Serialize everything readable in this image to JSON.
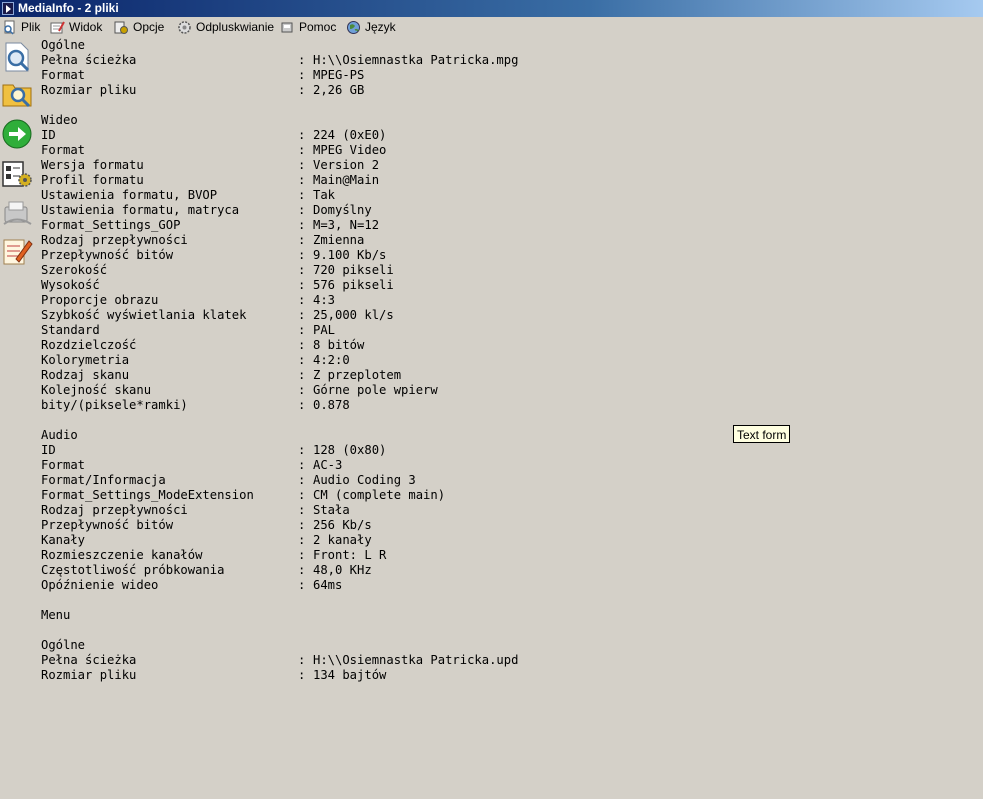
{
  "window": {
    "title": "MediaInfo - 2 pliki"
  },
  "menu": {
    "file": "Plik",
    "view": "Widok",
    "options": "Opcje",
    "debug": "Odpluskwianie",
    "help": "Pomoc",
    "language": "Język"
  },
  "tooltip": "Text form",
  "report": {
    "general1_title": "Ogólne",
    "general1": [
      {
        "key": "Pełna ścieżka",
        "sep": ":",
        "value": "H:\\\\Osiemnastka Patricka.mpg"
      },
      {
        "key": "Format",
        "sep": ":",
        "value": "MPEG-PS"
      },
      {
        "key": "Rozmiar pliku",
        "sep": ":",
        "value": "2,26 GB"
      }
    ],
    "video_title": "Wideo",
    "video": [
      {
        "key": "ID",
        "sep": ":",
        "value": "224 (0xE0)"
      },
      {
        "key": "Format",
        "sep": ":",
        "value": "MPEG Video"
      },
      {
        "key": "Wersja formatu",
        "sep": ":",
        "value": "Version 2"
      },
      {
        "key": "Profil formatu",
        "sep": ":",
        "value": "Main@Main"
      },
      {
        "key": "Ustawienia formatu, BVOP",
        "sep": ":",
        "value": "Tak"
      },
      {
        "key": "Ustawienia formatu, matryca",
        "sep": ":",
        "value": "Domyślny"
      },
      {
        "key": "Format_Settings_GOP",
        "sep": ":",
        "value": "M=3, N=12"
      },
      {
        "key": "Rodzaj przepływności",
        "sep": ":",
        "value": "Zmienna"
      },
      {
        "key": "Przepływność bitów",
        "sep": ":",
        "value": "9.100 Kb/s"
      },
      {
        "key": "Szerokość",
        "sep": ":",
        "value": "720 pikseli"
      },
      {
        "key": "Wysokość",
        "sep": ":",
        "value": "576 pikseli"
      },
      {
        "key": "Proporcje obrazu",
        "sep": ":",
        "value": "4:3"
      },
      {
        "key": "Szybkość wyświetlania klatek",
        "sep": ":",
        "value": "25,000 kl/s"
      },
      {
        "key": "Standard",
        "sep": ":",
        "value": "PAL"
      },
      {
        "key": "Rozdzielczość",
        "sep": ":",
        "value": "8 bitów"
      },
      {
        "key": "Kolorymetria",
        "sep": ":",
        "value": "4:2:0"
      },
      {
        "key": "Rodzaj skanu",
        "sep": ":",
        "value": "Z przeplotem"
      },
      {
        "key": "Kolejność skanu",
        "sep": ":",
        "value": "Górne pole wpierw"
      },
      {
        "key": "bity/(piksele*ramki)",
        "sep": ":",
        "value": "0.878"
      }
    ],
    "audio_title": "Audio",
    "audio": [
      {
        "key": "ID",
        "sep": ":",
        "value": "128 (0x80)"
      },
      {
        "key": "Format",
        "sep": ":",
        "value": "AC-3"
      },
      {
        "key": "Format/Informacja",
        "sep": ":",
        "value": "Audio Coding 3"
      },
      {
        "key": "Format_Settings_ModeExtension",
        "sep": ":",
        "value": "CM (complete main)"
      },
      {
        "key": "Rodzaj przepływności",
        "sep": ":",
        "value": "Stała"
      },
      {
        "key": "Przepływność bitów",
        "sep": ":",
        "value": "256 Kb/s"
      },
      {
        "key": "Kanały",
        "sep": ":",
        "value": "2 kanały"
      },
      {
        "key": "Rozmieszczenie kanałów",
        "sep": ":",
        "value": "Front: L R"
      },
      {
        "key": "Częstotliwość próbkowania",
        "sep": ":",
        "value": "48,0 KHz"
      },
      {
        "key": "Opóźnienie wideo",
        "sep": ":",
        "value": "64ms"
      }
    ],
    "menu_title": "Menu",
    "general2_title": "Ogólne",
    "general2": [
      {
        "key": "Pełna ścieżka",
        "sep": ":",
        "value": "H:\\\\Osiemnastka Patricka.upd"
      },
      {
        "key": "Rozmiar pliku",
        "sep": ":",
        "value": "134 bajtów"
      }
    ]
  },
  "icons": {
    "sidebar": [
      "open-file-icon",
      "open-folder-icon",
      "next-arrow-icon",
      "view-sheet-icon",
      "export-icon",
      "edit-notes-icon"
    ]
  }
}
